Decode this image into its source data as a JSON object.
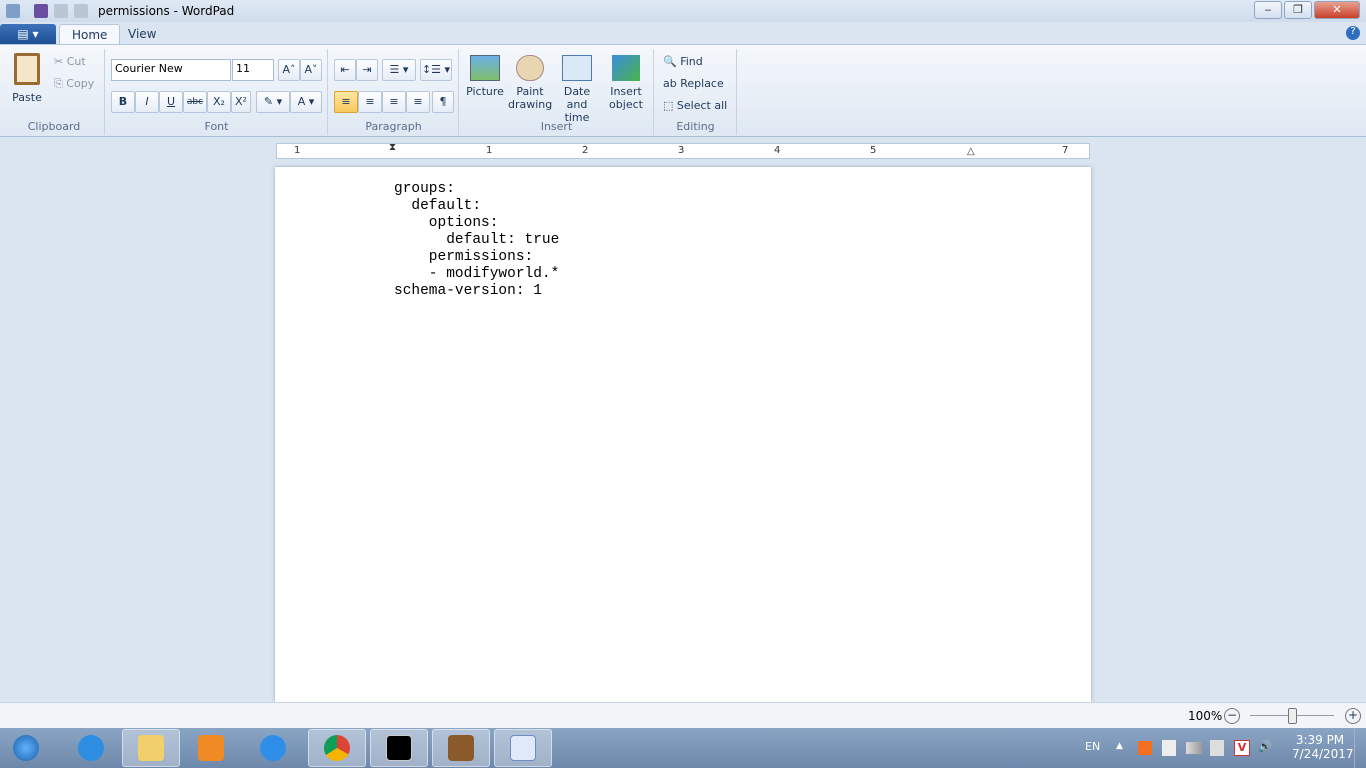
{
  "window": {
    "title": "permissions - WordPad",
    "minimize": "‒",
    "maximize": "❐",
    "close": "✕"
  },
  "tabs": {
    "file": "▤ ▾",
    "home": "Home",
    "view": "View",
    "help": "?"
  },
  "clipboard": {
    "paste": "Paste",
    "cut": "Cut",
    "copy": "Copy",
    "label": "Clipboard"
  },
  "font": {
    "family": "Courier New",
    "size": "11",
    "grow": "A˄",
    "shrink": "A˅",
    "bold": "B",
    "italic": "I",
    "underline": "U",
    "strike": "abc",
    "sub": "X₂",
    "sup": "X²",
    "highlight": "✎ ▾",
    "color": "A ▾",
    "label": "Font"
  },
  "paragraph": {
    "outdent": "⇤",
    "indent": "⇥",
    "list": "☰ ▾",
    "spacing": "↕☰ ▾",
    "left": "≡",
    "center": "≡",
    "right": "≡",
    "justify": "≡",
    "para": "¶",
    "label": "Paragraph"
  },
  "insert": {
    "picture": "Picture",
    "paint": "Paint drawing",
    "datetime": "Date and time",
    "object": "Insert object",
    "label": "Insert"
  },
  "editing": {
    "find": "Find",
    "replace": "Replace",
    "selectall": "Select all",
    "label": "Editing"
  },
  "ruler": [
    "1",
    "1",
    "2",
    "3",
    "4",
    "5",
    "7"
  ],
  "document": {
    "lines": [
      "groups:",
      "  default:",
      "    options:",
      "      default: true",
      "    permissions:",
      "    - modifyworld.*",
      "schema-version: 1"
    ]
  },
  "status": {
    "zoom": "100%",
    "zoom_out": "−",
    "zoom_in": "+",
    "zoom_level": 100
  },
  "tray": {
    "lang": "EN",
    "time": "3:39 PM",
    "date": "7/24/2017",
    "arrow": "▲"
  }
}
